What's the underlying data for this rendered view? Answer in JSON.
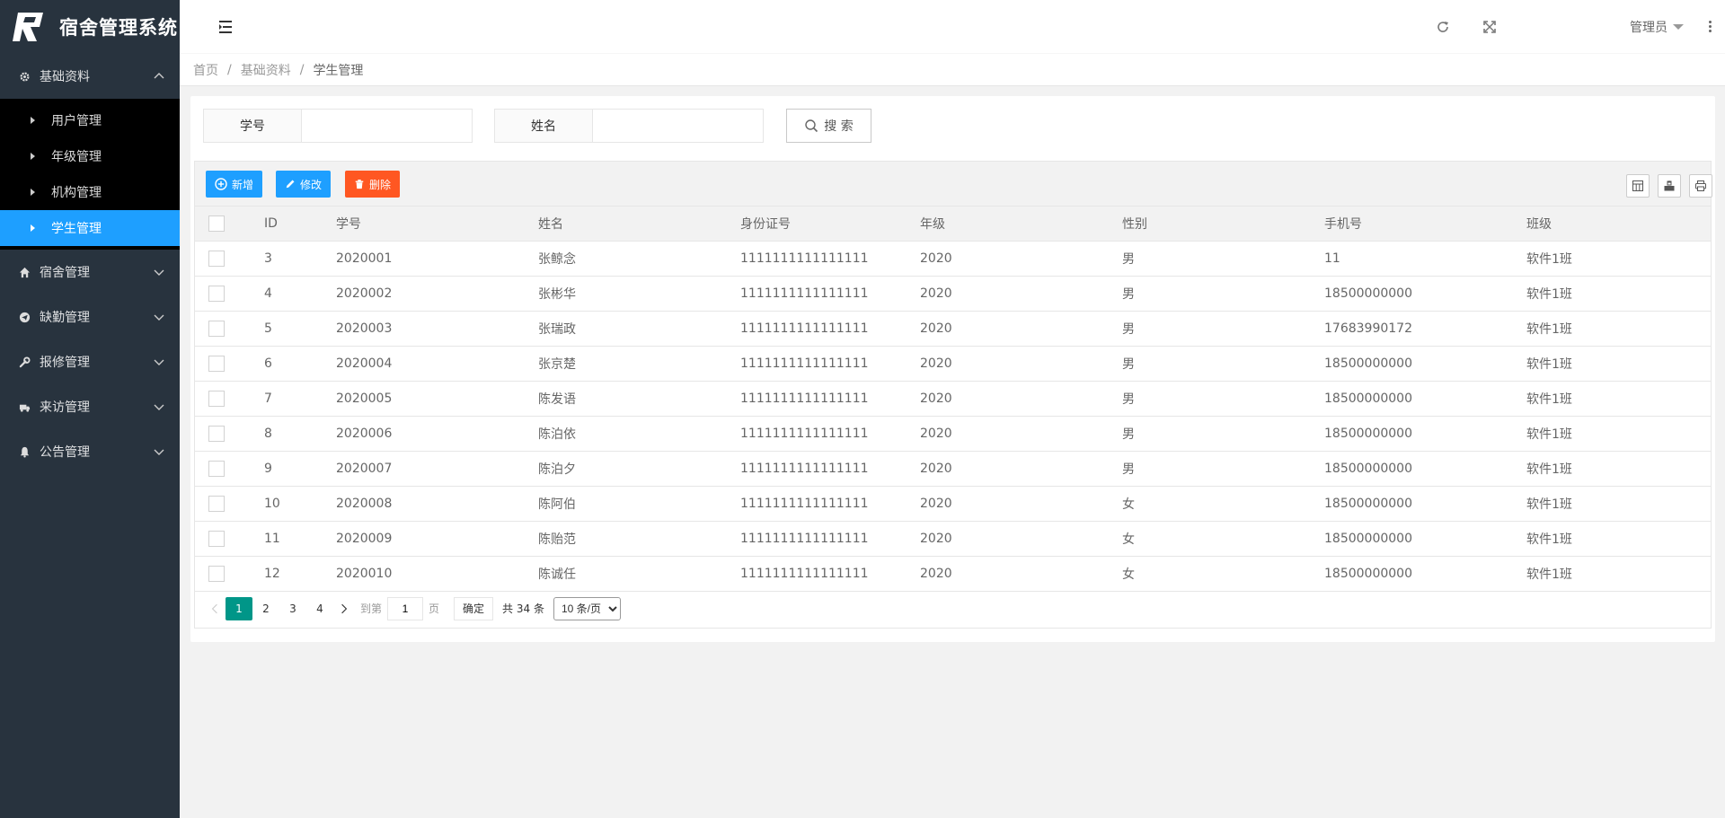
{
  "app": {
    "title": "宿舍管理系统"
  },
  "sidebar": {
    "groups": [
      {
        "label": "基础资料",
        "icon": "gear-icon",
        "expanded": true,
        "items": [
          {
            "label": "用户管理"
          },
          {
            "label": "年级管理"
          },
          {
            "label": "机构管理"
          },
          {
            "label": "学生管理",
            "active": true
          }
        ]
      },
      {
        "label": "宿舍管理",
        "icon": "home-icon"
      },
      {
        "label": "缺勤管理",
        "icon": "send-icon"
      },
      {
        "label": "报修管理",
        "icon": "wrench-icon"
      },
      {
        "label": "来访管理",
        "icon": "truck-icon"
      },
      {
        "label": "公告管理",
        "icon": "bell-icon"
      }
    ]
  },
  "header": {
    "user": "管理员"
  },
  "breadcrumb": {
    "home": "首页",
    "section": "基础资料",
    "current": "学生管理"
  },
  "search": {
    "student_no_label": "学号",
    "student_no_value": "",
    "name_label": "姓名",
    "name_value": "",
    "button": "搜 索"
  },
  "toolbar": {
    "add": "新增",
    "edit": "修改",
    "delete": "删除"
  },
  "table": {
    "columns": [
      "ID",
      "学号",
      "姓名",
      "身份证号",
      "年级",
      "性别",
      "手机号",
      "班级"
    ],
    "rows": [
      [
        "3",
        "2020001",
        "张鲸念",
        "1111111111111111",
        "2020",
        "男",
        "11",
        "软件1班"
      ],
      [
        "4",
        "2020002",
        "张彬华",
        "1111111111111111",
        "2020",
        "男",
        "18500000000",
        "软件1班"
      ],
      [
        "5",
        "2020003",
        "张瑞政",
        "1111111111111111",
        "2020",
        "男",
        "17683990172",
        "软件1班"
      ],
      [
        "6",
        "2020004",
        "张京楚",
        "1111111111111111",
        "2020",
        "男",
        "18500000000",
        "软件1班"
      ],
      [
        "7",
        "2020005",
        "陈发语",
        "1111111111111111",
        "2020",
        "男",
        "18500000000",
        "软件1班"
      ],
      [
        "8",
        "2020006",
        "陈泊依",
        "1111111111111111",
        "2020",
        "男",
        "18500000000",
        "软件1班"
      ],
      [
        "9",
        "2020007",
        "陈泊夕",
        "1111111111111111",
        "2020",
        "男",
        "18500000000",
        "软件1班"
      ],
      [
        "10",
        "2020008",
        "陈阿伯",
        "1111111111111111",
        "2020",
        "女",
        "18500000000",
        "软件1班"
      ],
      [
        "11",
        "2020009",
        "陈贻范",
        "1111111111111111",
        "2020",
        "女",
        "18500000000",
        "软件1班"
      ],
      [
        "12",
        "2020010",
        "陈诚任",
        "1111111111111111",
        "2020",
        "女",
        "18500000000",
        "软件1班"
      ]
    ]
  },
  "pager": {
    "pages": [
      "1",
      "2",
      "3",
      "4"
    ],
    "current": "1",
    "goto_label": "到第",
    "goto_value": "1",
    "page_suffix": "页",
    "ok": "确定",
    "total": "共 34 条",
    "page_size": "10 条/页"
  },
  "colors": {
    "sidebar_bg": "#28333e",
    "active_blue": "#1e9fff",
    "danger": "#ff5722",
    "pager_current": "#009688"
  }
}
